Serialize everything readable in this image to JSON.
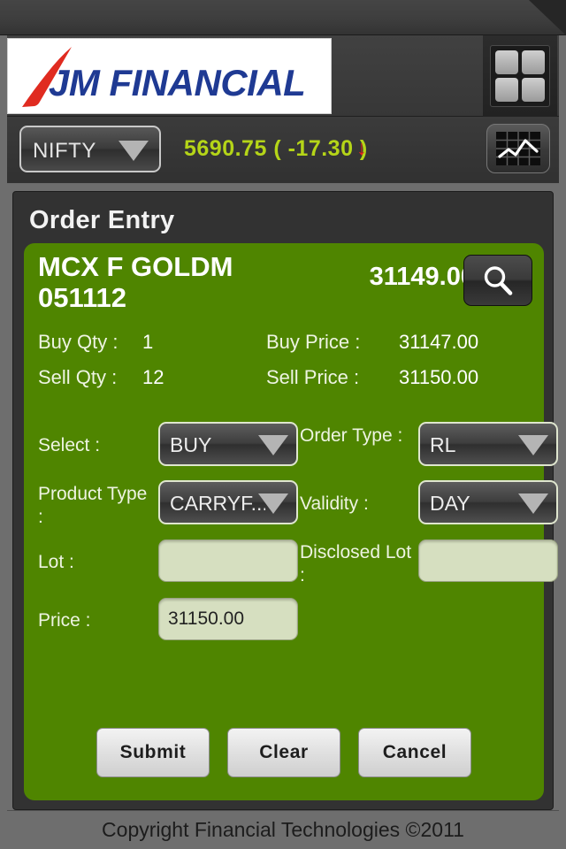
{
  "brand": {
    "name": "JM FINANCIAL",
    "grid_icon": "grid-menu-icon"
  },
  "ticker": {
    "symbol": "NIFTY",
    "value": "5690.75 ( -17.30 )",
    "direction_arrow": "↓",
    "direction": "down",
    "value_color": "#b5d518",
    "arrow_color": "#e8221c",
    "chart_icon": "chart-icon"
  },
  "panel": {
    "title": "Order Entry"
  },
  "order": {
    "symbol": "MCX F GOLDM 051112",
    "ltp": "31149.00",
    "search_icon": "search-icon",
    "quotes": [
      {
        "label": "Buy Qty :",
        "value": "1",
        "label2": "Buy Price :",
        "value2": "31147.00"
      },
      {
        "label": "Sell Qty :",
        "value": "12",
        "label2": "Sell Price :",
        "value2": "31150.00"
      }
    ],
    "fields": {
      "select_label": "Select :",
      "select_value": "BUY",
      "order_type_label": "Order Type :",
      "order_type_value": "RL",
      "product_type_label": "Product Type :",
      "product_type_value": "CARRYF...",
      "validity_label": "Validity :",
      "validity_value": "DAY",
      "lot_label": "Lot :",
      "lot_value": "",
      "disclosed_lot_label": "Disclosed Lot :",
      "disclosed_lot_value": "",
      "price_label": "Price :",
      "price_value": "31150.00"
    },
    "buttons": {
      "submit": "Submit",
      "clear": "Clear",
      "cancel": "Cancel"
    }
  },
  "footer": {
    "copyright": "Copyright Financial Technologies ©2011"
  },
  "colors": {
    "card_green": "#4f8500",
    "input_bg": "#d6dfc0",
    "brand_blue": "#1f3a93",
    "brand_red": "#e02b20"
  }
}
